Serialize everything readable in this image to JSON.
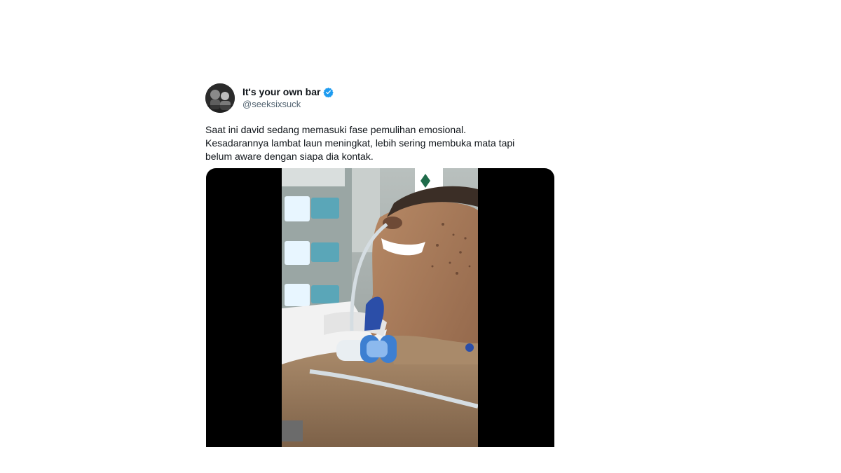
{
  "tweet": {
    "display_name": "It's your own bar",
    "handle": "@seeksixsuck",
    "verified": true,
    "text_lines": [
      "Saat ini david sedang memasuki fase pemulihan emosional.",
      "Kesadarannya lambat laun meningkat, lebih sering membuka mata tapi",
      "belum aware dengan siapa dia kontak."
    ]
  },
  "colors": {
    "verified": "#1d9bf0",
    "text": "#0f1419",
    "secondary_text": "#536471",
    "media_background": "#000000"
  },
  "icons": {
    "verified": "verified-badge-icon"
  }
}
